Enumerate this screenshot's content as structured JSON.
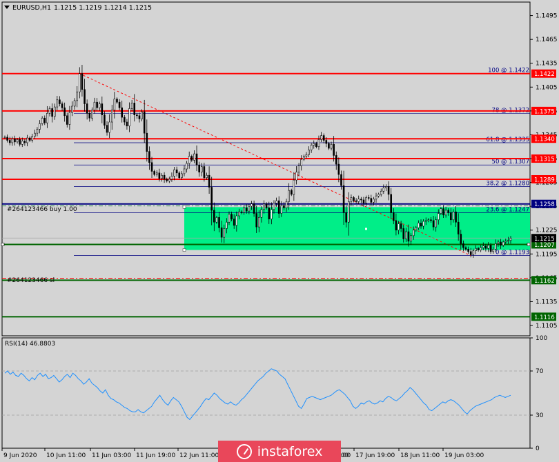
{
  "header": {
    "symbol": "EURUSD,H1",
    "quote": "1.1215 1.1219 1.1214 1.1215"
  },
  "colors": {
    "up": "#33cc33",
    "down": "#000000",
    "level": "#ff0000",
    "green_level": "#006400",
    "blue_level": "#000080",
    "zone": "#00ee88",
    "rsi": "#1e90ff",
    "trend": "#ff0000"
  },
  "chart_data": [
    {
      "type": "candlestick",
      "title": "EURUSD,H1",
      "ylim": [
        1.1092,
        1.1512
      ],
      "y_ticks": [
        "1.1495",
        "1.1465",
        "1.1435",
        "1.1405",
        "1.1375",
        "1.1345",
        "1.1315",
        "1.1285",
        "1.1255",
        "1.1225",
        "1.1195",
        "1.1165",
        "1.1135",
        "1.1105"
      ],
      "x_ticks": [
        "9 Jun 2020",
        "10 Jun 11:00",
        "11 Jun 03:00",
        "11 Jun 19:00",
        "12 Jun 11:00",
        "",
        "",
        "17 Jun 03:00",
        "17 Jun 19:00",
        "18 Jun 11:00",
        "19 Jun 03:00"
      ],
      "x_cutoff": "00",
      "close_series": [
        1.1342,
        1.1338,
        1.1335,
        1.134,
        1.1336,
        1.1339,
        1.1333,
        1.1337,
        1.1335,
        1.1341,
        1.1338,
        1.1343,
        1.1347,
        1.1352,
        1.1359,
        1.1366,
        1.136,
        1.1372,
        1.1378,
        1.1368,
        1.138,
        1.1389,
        1.1384,
        1.1379,
        1.1369,
        1.1358,
        1.1373,
        1.1381,
        1.1388,
        1.1399,
        1.1422,
        1.1402,
        1.1384,
        1.1372,
        1.1366,
        1.1376,
        1.1386,
        1.1379,
        1.1384,
        1.137,
        1.1357,
        1.1348,
        1.1361,
        1.1376,
        1.139,
        1.1386,
        1.1379,
        1.1367,
        1.1361,
        1.1356,
        1.1378,
        1.1385,
        1.137,
        1.1369,
        1.1365,
        1.1374,
        1.1347,
        1.1324,
        1.131,
        1.1299,
        1.1295,
        1.1297,
        1.129,
        1.1294,
        1.1289,
        1.1287,
        1.1289,
        1.1293,
        1.1301,
        1.1297,
        1.1291,
        1.1296,
        1.1302,
        1.1309,
        1.1318,
        1.1313,
        1.1321,
        1.1307,
        1.1298,
        1.1305,
        1.1291,
        1.1294,
        1.1279,
        1.125,
        1.1235,
        1.1241,
        1.1228,
        1.1216,
        1.1227,
        1.1235,
        1.1245,
        1.1239,
        1.1231,
        1.1243,
        1.1248,
        1.1247,
        1.1253,
        1.1249,
        1.1255,
        1.1258,
        1.1246,
        1.1229,
        1.1241,
        1.1251,
        1.1258,
        1.1253,
        1.1239,
        1.1251,
        1.1259,
        1.1262,
        1.1246,
        1.1256,
        1.1253,
        1.1261,
        1.1275,
        1.127,
        1.1288,
        1.1298,
        1.1306,
        1.1314,
        1.1318,
        1.132,
        1.1326,
        1.1332,
        1.1334,
        1.133,
        1.1339,
        1.1344,
        1.1338,
        1.1334,
        1.1328,
        1.1333,
        1.1319,
        1.1308,
        1.1295,
        1.1281,
        1.1247,
        1.1235,
        1.1261,
        1.1266,
        1.1262,
        1.1261,
        1.1264,
        1.1263,
        1.1259,
        1.1266,
        1.1265,
        1.126,
        1.1264,
        1.1268,
        1.127,
        1.1274,
        1.1278,
        1.128,
        1.127,
        1.1247,
        1.1237,
        1.1225,
        1.1233,
        1.1227,
        1.1214,
        1.1223,
        1.1211,
        1.1218,
        1.1225,
        1.1228,
        1.1234,
        1.123,
        1.1236,
        1.1237,
        1.1238,
        1.1237,
        1.1229,
        1.1238,
        1.1246,
        1.1252,
        1.1244,
        1.125,
        1.1247,
        1.1238,
        1.1248,
        1.1235,
        1.122,
        1.1208,
        1.1203,
        1.1201,
        1.1198,
        1.1194,
        1.1199,
        1.1202,
        1.12,
        1.1203,
        1.1205,
        1.1202,
        1.1206,
        1.1198,
        1.1201,
        1.1208,
        1.121,
        1.1206,
        1.121,
        1.1211,
        1.1212,
        1.1215
      ],
      "price_levels": [
        {
          "value": 1.1422,
          "label": "1.1422",
          "kind": "red"
        },
        {
          "value": 1.1375,
          "label": "1.1375",
          "kind": "red"
        },
        {
          "value": 1.134,
          "label": "1.1340",
          "kind": "red"
        },
        {
          "value": 1.1315,
          "label": "1.1315",
          "kind": "red"
        },
        {
          "value": 1.1289,
          "label": "1.1289",
          "kind": "red"
        },
        {
          "value": 1.1258,
          "label": "1.1258",
          "kind": "blue"
        },
        {
          "value": 1.1162,
          "label": "1.1162",
          "kind": "green"
        },
        {
          "value": 1.1116,
          "label": "1.1116",
          "kind": "green"
        }
      ],
      "fib_levels": [
        {
          "value": 1.1422,
          "label": "100 @ 1.1422"
        },
        {
          "value": 1.1372,
          "label": "78 @ 1.1372"
        },
        {
          "value": 1.1335,
          "label": "61.8 @ 1.1335"
        },
        {
          "value": 1.1307,
          "label": "50 @ 1.1307"
        },
        {
          "value": 1.128,
          "label": "38.2 @ 1.1280"
        },
        {
          "value": 1.1247,
          "label": "23.6 @ 1.1247"
        },
        {
          "value": 1.1193,
          "label": "0 @ 1.1193"
        }
      ],
      "current_price": {
        "value": 1.1215,
        "label": "1.1215"
      },
      "entry_line": {
        "value": 1.1207,
        "label": "1.1207"
      },
      "order_labels": {
        "buy": "#264123466 buy 1.00",
        "sl": "#264123466 sl"
      },
      "zone": {
        "from": 1.12,
        "to": 1.1254
      }
    },
    {
      "type": "line",
      "title": "RSI(14) 46.8803",
      "ylim": [
        0,
        100
      ],
      "y_ticks": [
        "100",
        "70",
        "30",
        "0"
      ],
      "levels": [
        70,
        30
      ],
      "values": [
        68,
        70,
        67,
        69,
        66,
        65,
        68,
        66,
        63,
        61,
        64,
        62,
        66,
        68,
        65,
        67,
        63,
        64,
        66,
        63,
        60,
        62,
        65,
        67,
        64,
        68,
        66,
        63,
        61,
        58,
        60,
        63,
        59,
        57,
        55,
        52,
        50,
        53,
        48,
        45,
        44,
        42,
        41,
        39,
        37,
        36,
        34,
        33,
        33,
        35,
        33,
        32,
        34,
        36,
        38,
        42,
        45,
        48,
        44,
        41,
        39,
        43,
        46,
        44,
        42,
        38,
        33,
        28,
        26,
        29,
        32,
        35,
        38,
        42,
        45,
        44,
        47,
        50,
        48,
        45,
        43,
        41,
        40,
        42,
        40,
        39,
        41,
        44,
        46,
        49,
        52,
        55,
        58,
        61,
        63,
        65,
        68,
        70,
        72,
        71,
        70,
        67,
        65,
        63,
        58,
        53,
        48,
        43,
        38,
        36,
        40,
        45,
        46,
        47,
        46,
        45,
        44,
        45,
        46,
        47,
        48,
        50,
        52,
        53,
        51,
        49,
        46,
        43,
        38,
        36,
        38,
        41,
        40,
        42,
        43,
        41,
        40,
        41,
        43,
        42,
        45,
        47,
        46,
        44,
        43,
        45,
        47,
        50,
        52,
        55,
        53,
        50,
        47,
        44,
        41,
        39,
        35,
        34,
        36,
        38,
        40,
        42,
        41,
        43,
        44,
        43,
        41,
        39,
        36,
        33,
        31,
        34,
        36,
        38,
        39,
        40,
        41,
        42,
        43,
        44,
        46,
        47,
        48,
        47,
        46,
        47,
        48
      ]
    }
  ],
  "watermark": "instaforex"
}
